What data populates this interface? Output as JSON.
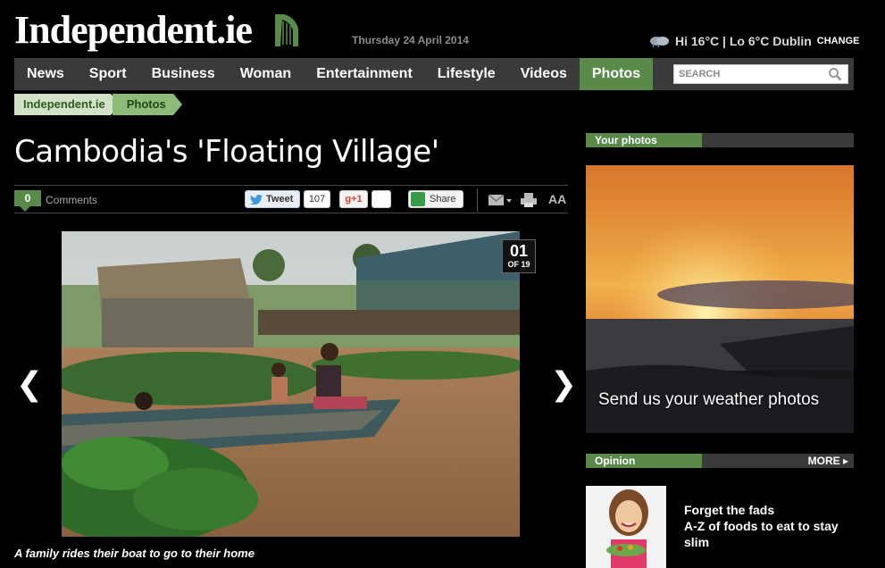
{
  "site": {
    "logo": "Independent.ie",
    "date": "Thursday 24 April 2014"
  },
  "weather": {
    "text": "Hi 16°C | Lo 6°C Dublin",
    "change": "CHANGE"
  },
  "nav": {
    "items": [
      "News",
      "Sport",
      "Business",
      "Woman",
      "Entertainment",
      "Lifestyle",
      "Videos",
      "Photos"
    ],
    "active": "Photos"
  },
  "search": {
    "placeholder": "SEARCH"
  },
  "breadcrumb": [
    "Independent.ie",
    "Photos"
  ],
  "article": {
    "title": "Cambodia's 'Floating Village'",
    "comments_count": "0",
    "comments_label": "Comments",
    "tweet_label": "Tweet",
    "tweet_count": "107",
    "gplus_label": "+1",
    "share_label": "Share",
    "font_size_label": "AA"
  },
  "gallery": {
    "current": "01",
    "total_label": "OF 19",
    "prev": "❮",
    "next": "❯",
    "caption": "A family rides their boat to go to their home"
  },
  "sidebar": {
    "your_photos": {
      "heading": "Your photos",
      "promo": "Send us your weather photos"
    },
    "opinion": {
      "heading": "Opinion",
      "more": "MORE ▸",
      "title": "Forget the fads",
      "subtitle": "A-Z of foods to eat to stay slim"
    }
  },
  "colors": {
    "accent_green": "#5a8a4a",
    "nav_bg": "#3a3a3a",
    "background": "#000000"
  }
}
